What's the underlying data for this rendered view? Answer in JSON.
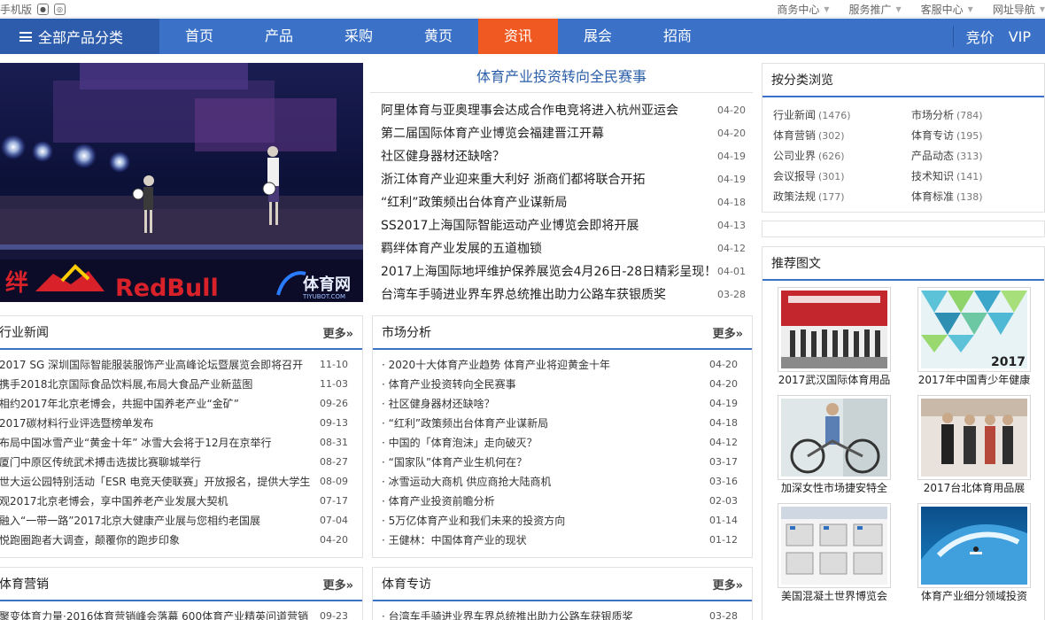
{
  "topbar": {
    "mobile_label": "手机版",
    "menus": [
      "商务中心",
      "服务推广",
      "客服中心",
      "网址导航"
    ]
  },
  "nav": {
    "category_label": "全部产品分类",
    "items": [
      "首页",
      "产品",
      "采购",
      "黄页",
      "资讯",
      "展会",
      "招商"
    ],
    "active": "资讯",
    "right": [
      "竞价",
      "VIP"
    ],
    "colors": {
      "nav_bg": "#3b72c7",
      "category_bg": "#2e5cac",
      "active_bg": "#f05a22"
    }
  },
  "hero": {
    "brand_text": "RedBull",
    "brand_prefix": "绊",
    "watermark": "体育网",
    "watermark_sub": "TIYUBOT.COM"
  },
  "headlines": {
    "featured": "体育产业投资转向全民赛事",
    "items": [
      {
        "title": "阿里体育与亚奥理事会达成合作电竞将进入杭州亚运会",
        "date": "04-20"
      },
      {
        "title": "第二届国际体育产业博览会福建晋江开幕",
        "date": "04-20"
      },
      {
        "title": "社区健身器材还缺啥？",
        "date": "04-19"
      },
      {
        "title": "浙江体育产业迎来重大利好 浙商们都将联合开拓",
        "date": "04-19"
      },
      {
        "title": "“红利”政策频出台体育产业谋新局",
        "date": "04-18"
      },
      {
        "title": "SS2017上海国际智能运动产业博览会即将开展",
        "date": "04-13"
      },
      {
        "title": "羁绊体育产业发展的五道枷锁",
        "date": "04-12"
      },
      {
        "title": "2017上海国际地坪维护保养展览会4月26日-28日精彩呈现！",
        "date": "04-01"
      },
      {
        "title": "台湾车手骑进业界车界总统推出助力公路车获银质奖",
        "date": "03-28"
      }
    ]
  },
  "industry_news": {
    "title": "行业新闻",
    "more": "更多»",
    "items": [
      {
        "title": "2017 SG 深圳国际智能服装服饰产业高峰论坛暨展览会即将召开",
        "date": "11-10"
      },
      {
        "title": "携手2018北京国际食品饮料展,布局大食品产业新蓝图",
        "date": "11-03"
      },
      {
        "title": "相约2017年北京老博会，共掘中国养老产业“金矿”",
        "date": "09-26"
      },
      {
        "title": "2017碳材料行业评选暨榜单发布",
        "date": "09-13"
      },
      {
        "title": "布局中国冰雪产业“黄金十年” 冰雪大会将于12月在京举行",
        "date": "08-31"
      },
      {
        "title": "厦门中原区传统武术搏击选拔比赛聊城举行",
        "date": "08-27"
      },
      {
        "title": "世大运公园特别活动「ESR 电竞天使联赛」开放报名，提供大学生",
        "date": "08-09"
      },
      {
        "title": "观2017北京老博会，享中国养老产业发展大契机",
        "date": "07-17"
      },
      {
        "title": "融入“一带一路”2017北京大健康产业展与您相约老国展",
        "date": "07-04"
      },
      {
        "title": "悦跑圈跑者大调查，颠覆你的跑步印象",
        "date": "04-20"
      }
    ]
  },
  "market_analysis": {
    "title": "市场分析",
    "more": "更多»",
    "items": [
      {
        "title": "· 2020十大体育产业趋势 体育产业将迎黄金十年",
        "date": "04-20"
      },
      {
        "title": "· 体育产业投资转向全民赛事",
        "date": "04-20"
      },
      {
        "title": "· 社区健身器材还缺啥？",
        "date": "04-19"
      },
      {
        "title": "· “红利”政策频出台体育产业谋新局",
        "date": "04-18"
      },
      {
        "title": "· 中国的「体育泡沫」走向破灭？",
        "date": "04-12"
      },
      {
        "title": "· “国家队”体育产业生机何在？",
        "date": "03-17"
      },
      {
        "title": "· 冰雪运动大商机 供应商抢大陆商机",
        "date": "03-16"
      },
      {
        "title": "· 体育产业投资前瞻分析",
        "date": "02-03"
      },
      {
        "title": "· 5万亿体育产业和我们未来的投资方向",
        "date": "01-14"
      },
      {
        "title": "· 王健林：中国体育产业的现状",
        "date": "01-12"
      }
    ]
  },
  "sports_marketing": {
    "title": "体育营销",
    "more": "更多»",
    "items": [
      {
        "title": "聚变体育力量·2016体育营销峰会落幕 600体育产业精英问道营销",
        "date": "09-23"
      }
    ]
  },
  "sports_special": {
    "title": "体育专访",
    "more": "更多»",
    "items": [
      {
        "title": "· 台湾车手骑进业界车界总统推出助力公路车获银质奖",
        "date": "03-28"
      }
    ]
  },
  "browse": {
    "title": "按分类浏览",
    "categories": [
      {
        "name": "行业新闻",
        "count": "(1476)"
      },
      {
        "name": "市场分析",
        "count": "(784)"
      },
      {
        "name": "体育营销",
        "count": "(302)"
      },
      {
        "name": "体育专访",
        "count": "(195)"
      },
      {
        "name": "公司业界",
        "count": "(626)"
      },
      {
        "name": "产品动态",
        "count": "(313)"
      },
      {
        "name": "会议报导",
        "count": "(301)"
      },
      {
        "name": "技术知识",
        "count": "(141)"
      },
      {
        "name": "政策法规",
        "count": "(177)"
      },
      {
        "name": "体育标准",
        "count": "(138)"
      }
    ]
  },
  "photos": {
    "title": "推荐图文",
    "items": [
      {
        "caption": "2017武汉国际体育用品",
        "year_label": ""
      },
      {
        "caption": "2017年中国青少年健康",
        "year_label": "2017"
      },
      {
        "caption": "加深女性市场捷安特全",
        "year_label": ""
      },
      {
        "caption": "2017台北体育用品展",
        "year_label": ""
      },
      {
        "caption": "美国混凝土世界博览会",
        "year_label": ""
      },
      {
        "caption": "体育产业细分领域投资",
        "year_label": ""
      }
    ]
  }
}
